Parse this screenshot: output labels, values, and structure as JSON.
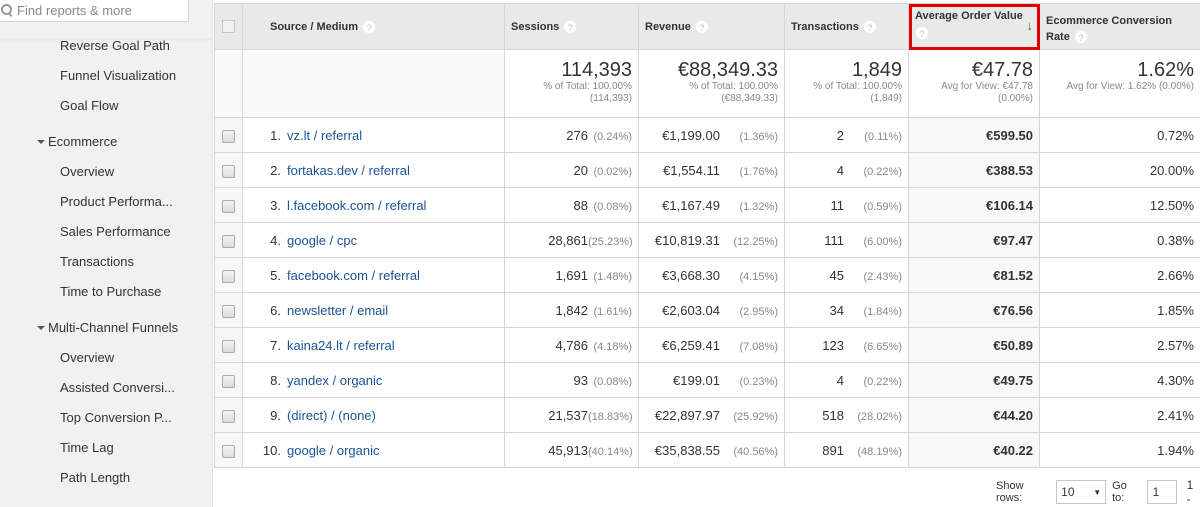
{
  "sidebar": {
    "search_placeholder": "Find reports & more",
    "items_top": [
      {
        "label": "Reverse Goal Path"
      },
      {
        "label": "Funnel Visualization"
      },
      {
        "label": "Goal Flow"
      }
    ],
    "ecommerce": {
      "label": "Ecommerce",
      "items": [
        {
          "label": "Overview"
        },
        {
          "label": "Product Performa..."
        },
        {
          "label": "Sales Performance"
        },
        {
          "label": "Transactions"
        },
        {
          "label": "Time to Purchase"
        }
      ]
    },
    "mcf": {
      "label": "Multi-Channel Funnels",
      "items": [
        {
          "label": "Overview"
        },
        {
          "label": "Assisted Conversi..."
        },
        {
          "label": "Top Conversion P..."
        },
        {
          "label": "Time Lag"
        },
        {
          "label": "Path Length"
        }
      ]
    }
  },
  "table": {
    "columns": {
      "source": "Source / Medium",
      "sessions": "Sessions",
      "revenue": "Revenue",
      "transactions": "Transactions",
      "aov": "Average Order Value",
      "conv": "Ecommerce Conversion Rate",
      "help_glyph": "?",
      "sort_glyph": "↓"
    },
    "sorted_column": "Average Order Value",
    "sort_direction": "descending",
    "highlight_color": "#e00000",
    "totals": {
      "sessions": {
        "value": "114,393",
        "line1": "% of Total: 100.00%",
        "line2": "(114,393)"
      },
      "revenue": {
        "value": "€88,349.33",
        "line1": "% of Total: 100.00%",
        "line2": "(€88,349.33)"
      },
      "transactions": {
        "value": "1,849",
        "line1": "% of Total: 100.00%",
        "line2": "(1,849)"
      },
      "aov": {
        "value": "€47.78",
        "line1": "Avg for View: €47.78",
        "line2": "(0.00%)"
      },
      "conv": {
        "value": "1.62%",
        "line1": "Avg for View: 1.62% (0.00%)"
      }
    },
    "rows": [
      {
        "index": "1.",
        "source": "vz.lt / referral",
        "sessions": "276",
        "sessions_pct": "(0.24%)",
        "revenue": "€1,199.00",
        "revenue_pct": "(1.36%)",
        "transactions": "2",
        "transactions_pct": "(0.11%)",
        "aov": "€599.50",
        "conv": "0.72%"
      },
      {
        "index": "2.",
        "source": "fortakas.dev / referral",
        "sessions": "20",
        "sessions_pct": "(0.02%)",
        "revenue": "€1,554.11",
        "revenue_pct": "(1.76%)",
        "transactions": "4",
        "transactions_pct": "(0.22%)",
        "aov": "€388.53",
        "conv": "20.00%"
      },
      {
        "index": "3.",
        "source": "l.facebook.com / referral",
        "sessions": "88",
        "sessions_pct": "(0.08%)",
        "revenue": "€1,167.49",
        "revenue_pct": "(1.32%)",
        "transactions": "11",
        "transactions_pct": "(0.59%)",
        "aov": "€106.14",
        "conv": "12.50%"
      },
      {
        "index": "4.",
        "source": "google / cpc",
        "sessions": "28,861",
        "sessions_pct": "(25.23%)",
        "revenue": "€10,819.31",
        "revenue_pct": "(12.25%)",
        "transactions": "111",
        "transactions_pct": "(6.00%)",
        "aov": "€97.47",
        "conv": "0.38%"
      },
      {
        "index": "5.",
        "source": "facebook.com / referral",
        "sessions": "1,691",
        "sessions_pct": "(1.48%)",
        "revenue": "€3,668.30",
        "revenue_pct": "(4.15%)",
        "transactions": "45",
        "transactions_pct": "(2.43%)",
        "aov": "€81.52",
        "conv": "2.66%"
      },
      {
        "index": "6.",
        "source": "newsletter / email",
        "sessions": "1,842",
        "sessions_pct": "(1.61%)",
        "revenue": "€2,603.04",
        "revenue_pct": "(2.95%)",
        "transactions": "34",
        "transactions_pct": "(1.84%)",
        "aov": "€76.56",
        "conv": "1.85%"
      },
      {
        "index": "7.",
        "source": "kaina24.lt / referral",
        "sessions": "4,786",
        "sessions_pct": "(4.18%)",
        "revenue": "€6,259.41",
        "revenue_pct": "(7.08%)",
        "transactions": "123",
        "transactions_pct": "(6.65%)",
        "aov": "€50.89",
        "conv": "2.57%"
      },
      {
        "index": "8.",
        "source": "yandex / organic",
        "sessions": "93",
        "sessions_pct": "(0.08%)",
        "revenue": "€199.01",
        "revenue_pct": "(0.23%)",
        "transactions": "4",
        "transactions_pct": "(0.22%)",
        "aov": "€49.75",
        "conv": "4.30%"
      },
      {
        "index": "9.",
        "source": "(direct) / (none)",
        "sessions": "21,537",
        "sessions_pct": "(18.83%)",
        "revenue": "€22,897.97",
        "revenue_pct": "(25.92%)",
        "transactions": "518",
        "transactions_pct": "(28.02%)",
        "aov": "€44.20",
        "conv": "2.41%"
      },
      {
        "index": "10.",
        "source": "google / organic",
        "sessions": "45,913",
        "sessions_pct": "(40.14%)",
        "revenue": "€35,838.55",
        "revenue_pct": "(40.56%)",
        "transactions": "891",
        "transactions_pct": "(48.19%)",
        "aov": "€40.22",
        "conv": "1.94%"
      }
    ]
  },
  "footer": {
    "show_rows_label": "Show rows:",
    "show_rows_value": "10",
    "goto_label": "Go to:",
    "goto_value": "1",
    "range_text": "1 -"
  }
}
